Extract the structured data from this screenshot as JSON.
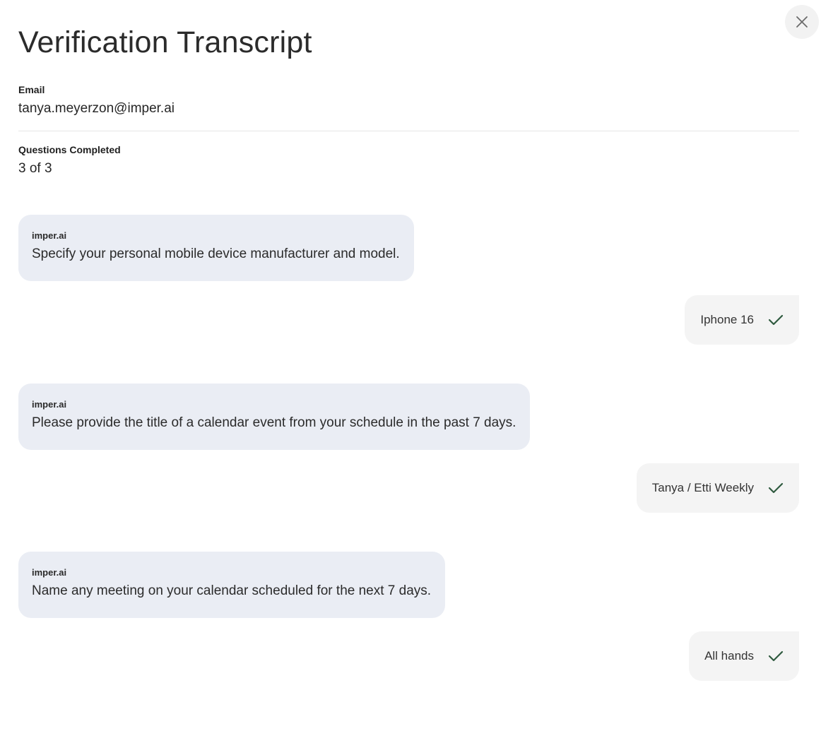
{
  "header": {
    "title": "Verification Transcript",
    "close_icon": "close-icon"
  },
  "fields": {
    "email_label": "Email",
    "email_value": "tanya.meyerzon@imper.ai",
    "progress_label": "Questions Completed",
    "progress_value": "3 of 3"
  },
  "transcript": [
    {
      "sender": "imper.ai",
      "question": "Specify your personal mobile device manufacturer and model.",
      "answer": "Iphone 16",
      "status_icon": "check-icon"
    },
    {
      "sender": "imper.ai",
      "question": "Please provide the title of a calendar event from your schedule in the past 7 days.",
      "answer": "Tanya / Etti Weekly",
      "status_icon": "check-icon"
    },
    {
      "sender": "imper.ai",
      "question": "Name any meeting on your calendar scheduled for the next 7 days.",
      "answer": "All hands",
      "status_icon": "check-icon"
    }
  ],
  "colors": {
    "question_bubble": "#eaedf4",
    "answer_bubble": "#f4f4f4",
    "check": "#2f5a3f"
  }
}
